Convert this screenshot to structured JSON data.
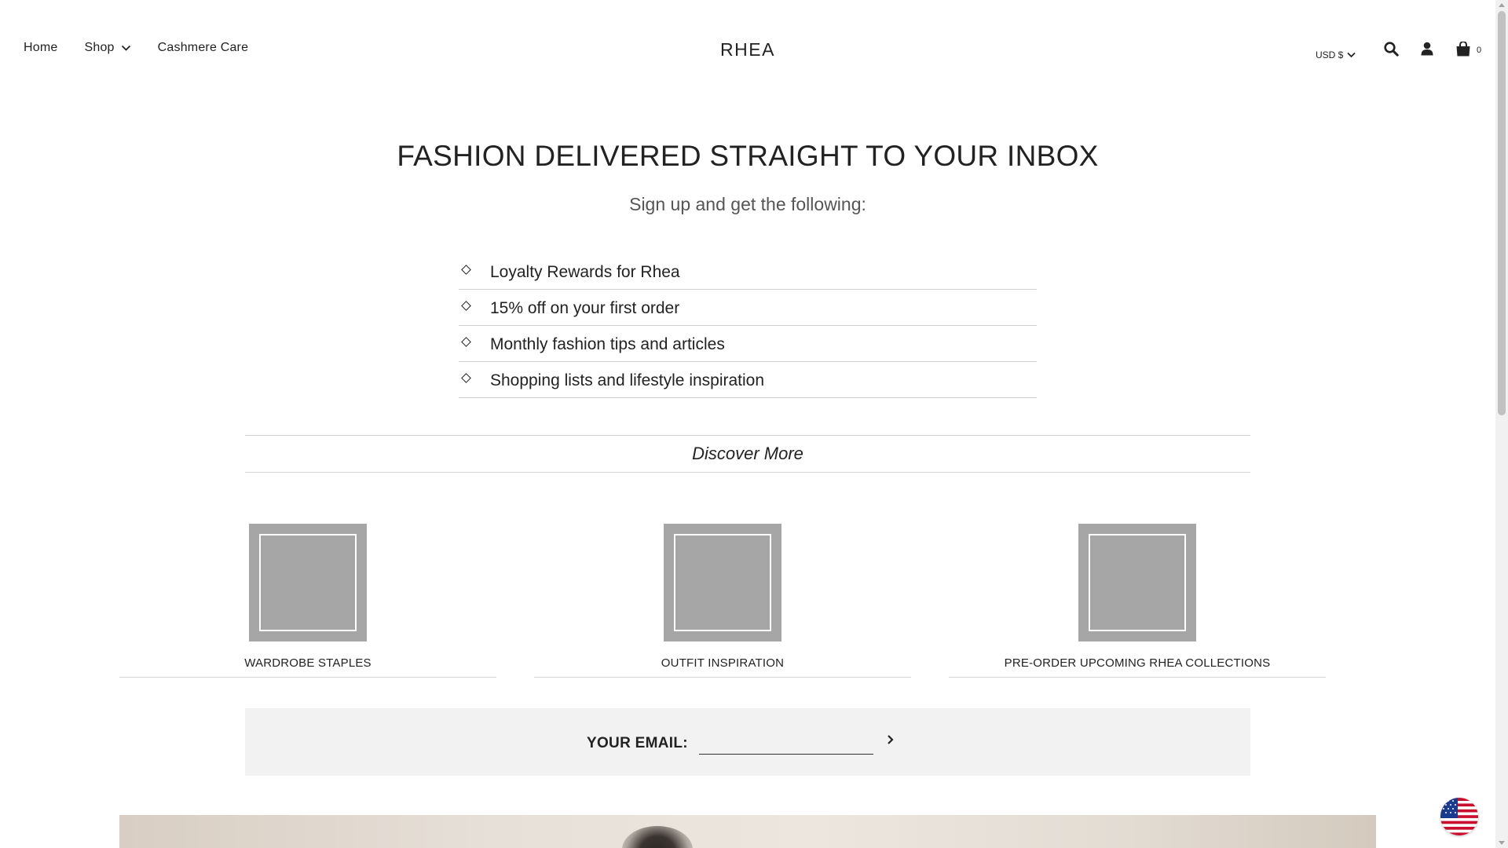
{
  "header": {
    "nav": [
      {
        "label": "Home"
      },
      {
        "label": "Shop"
      },
      {
        "label": "Cashmere Care"
      }
    ],
    "logo": "RHEA",
    "currency": "USD $",
    "cart_count": "0",
    "icons": [
      "search-icon",
      "account-icon",
      "cart-icon"
    ]
  },
  "hero": {
    "title": "FASHION DELIVERED STRAIGHT TO YOUR INBOX",
    "subtitle": "Sign up and get the following:"
  },
  "benefits": [
    "Loyalty Rewards for Rhea",
    "15% off on your first order",
    "Monthly fashion tips and articles",
    "Shopping lists and lifestyle inspiration"
  ],
  "discover": "Discover More",
  "cards": [
    {
      "label": "WARDROBE STAPLES"
    },
    {
      "label": "OUTFIT INSPIRATION"
    },
    {
      "label": "PRE-ORDER UPCOMING RHEA COLLECTIONS"
    }
  ],
  "email": {
    "label": "YOUR EMAIL:",
    "value": "",
    "placeholder": ""
  },
  "colors": {
    "text": "#222222",
    "subtext": "#555555",
    "divider": "#d4d4d4",
    "placeholder_gray": "#a6a6a6",
    "email_bar_bg": "#f2f2f3"
  }
}
